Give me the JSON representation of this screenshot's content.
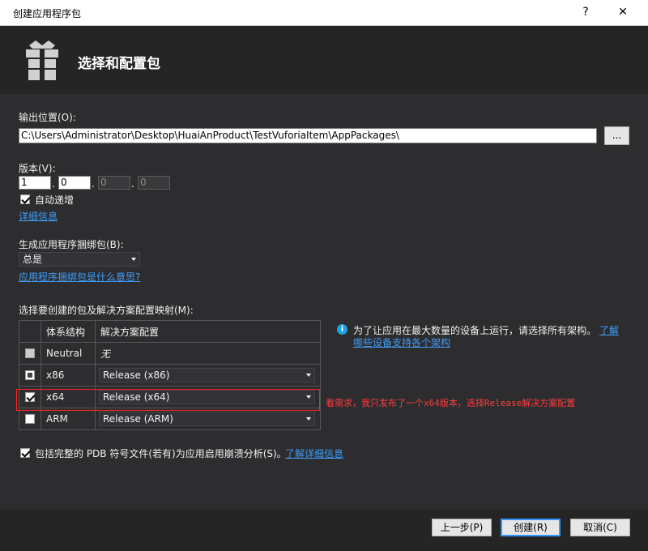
{
  "window": {
    "title": "创建应用程序包",
    "help_glyph": "?",
    "close_glyph": "✕"
  },
  "header": {
    "title": "选择和配置包",
    "icon": "package-gift-icon"
  },
  "output": {
    "label": "输出位置(O):",
    "path": "C:\\Users\\Administrator\\Desktop\\HuaiAnProduct\\TestVuforiaItem\\AppPackages\\",
    "browse_label": "..."
  },
  "version": {
    "label": "版本(V):",
    "major": "1",
    "minor": "0",
    "build": "0",
    "revision": "0",
    "auto_increment_label": "自动递增",
    "auto_increment_checked": true,
    "details_link": "详细信息"
  },
  "bundle": {
    "label": "生成应用程序捆绑包(B):",
    "selected": "总是",
    "help_link": "应用程序捆绑包是什么意思?"
  },
  "mapping": {
    "label": "选择要创建的包及解决方案配置映射(M):",
    "columns": [
      "体系结构",
      "解决方案配置"
    ],
    "rows": [
      {
        "arch": "Neutral",
        "config": "无",
        "state": "grey"
      },
      {
        "arch": "x86",
        "config": "Release (x86)",
        "state": "indeterminate"
      },
      {
        "arch": "x64",
        "config": "Release (x64)",
        "state": "checked"
      },
      {
        "arch": "ARM",
        "config": "Release (ARM)",
        "state": "unchecked"
      }
    ],
    "info_text": "为了让应用在最大数量的设备上运行，请选择所有架构。",
    "info_link_1": "了解",
    "info_link_2": "哪些设备支持各个架构"
  },
  "annotation": {
    "text": "看需求，我只发布了一个x64版本，选择Release解决方案配置",
    "color": "#ff3b3b"
  },
  "pdb": {
    "label": "包括完整的 PDB 符号文件(若有)为应用启用崩溃分析(S)。",
    "checked": true,
    "link": "了解详细信息"
  },
  "footer": {
    "back": "上一步(P)",
    "create": "创建(R)",
    "cancel": "取消(C)"
  },
  "colors": {
    "background": "#2d2d30",
    "link": "#3f9cf7",
    "accent": "#3399ff"
  }
}
